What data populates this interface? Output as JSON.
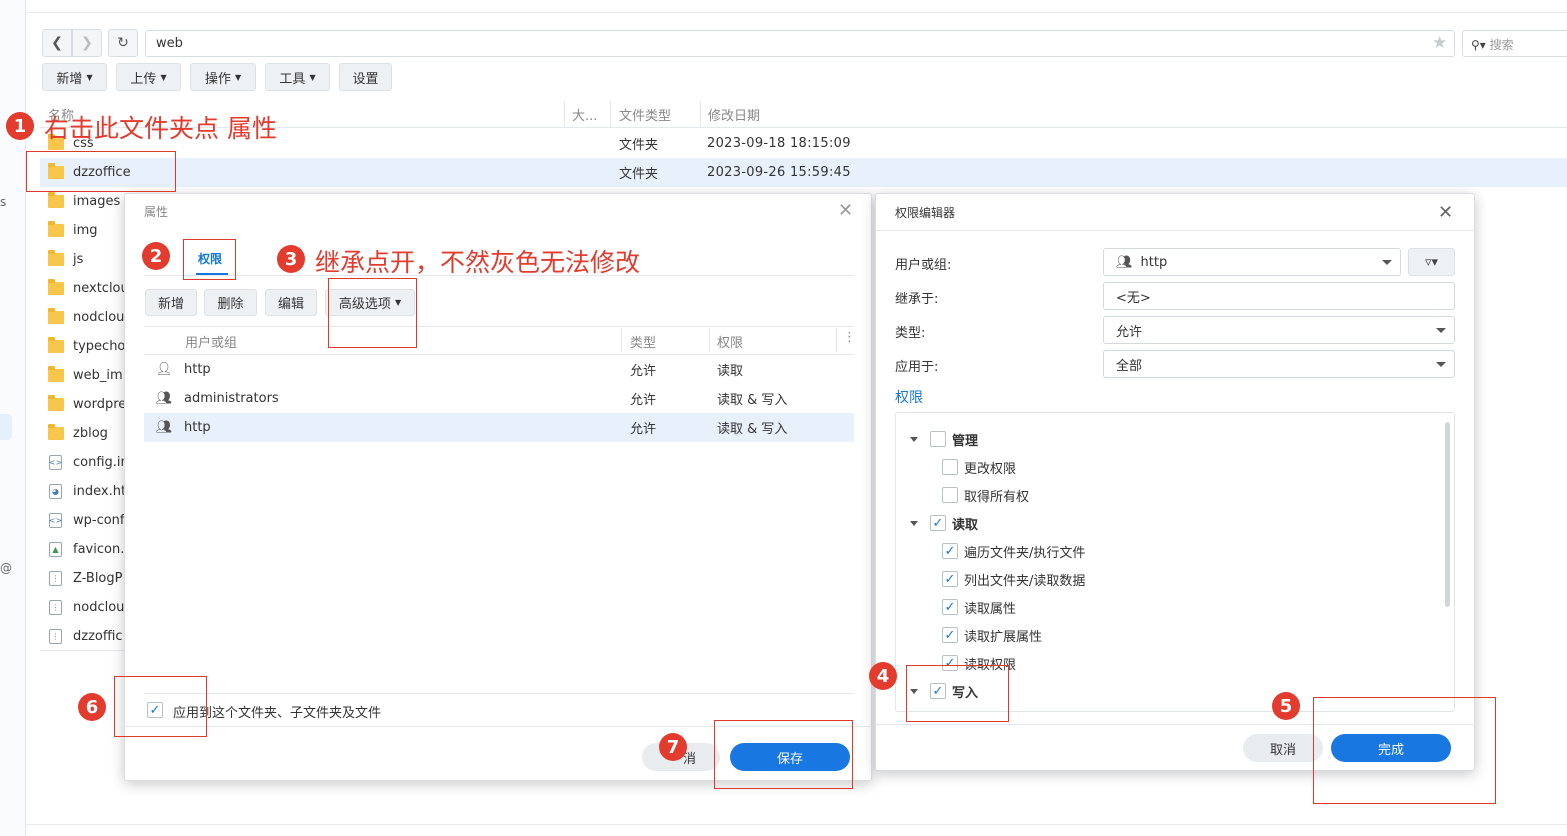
{
  "sidebar_strip": {
    "chars": [
      "s",
      "@"
    ]
  },
  "toolbar": {
    "back_icon": "chevron-left",
    "forward_icon": "chevron-right",
    "refresh_icon": "refresh",
    "path": "web",
    "search_placeholder": "搜索",
    "buttons": [
      "新增",
      "上传",
      "操作",
      "工具",
      "设置"
    ]
  },
  "file_list": {
    "columns": [
      "名称",
      "大...",
      "文件类型",
      "修改日期"
    ],
    "rows": [
      {
        "name": "css",
        "type": "文件夹",
        "date": "2023-09-18 18:15:09",
        "icon": "folder"
      },
      {
        "name": "dzzoffice",
        "type": "文件夹",
        "date": "2023-09-26 15:59:45",
        "icon": "folder"
      },
      {
        "name": "images",
        "type": "",
        "date": "",
        "icon": "folder"
      },
      {
        "name": "img",
        "type": "",
        "date": "",
        "icon": "folder"
      },
      {
        "name": "js",
        "type": "",
        "date": "",
        "icon": "folder"
      },
      {
        "name": "nextclou",
        "type": "",
        "date": "",
        "icon": "folder"
      },
      {
        "name": "nodclou",
        "type": "",
        "date": "",
        "icon": "folder"
      },
      {
        "name": "typecho",
        "type": "",
        "date": "",
        "icon": "folder"
      },
      {
        "name": "web_im",
        "type": "",
        "date": "",
        "icon": "folder"
      },
      {
        "name": "wordpre",
        "type": "",
        "date": "",
        "icon": "folder"
      },
      {
        "name": "zblog",
        "type": "",
        "date": "",
        "icon": "folder"
      },
      {
        "name": "config.in",
        "type": "",
        "date": "",
        "icon": "code"
      },
      {
        "name": "index.ht",
        "type": "",
        "date": "",
        "icon": "web"
      },
      {
        "name": "wp-conf",
        "type": "",
        "date": "",
        "icon": "code"
      },
      {
        "name": "favicon.",
        "type": "",
        "date": "",
        "icon": "image"
      },
      {
        "name": "Z-BlogP",
        "type": "",
        "date": "",
        "icon": "zip"
      },
      {
        "name": "nodclou",
        "type": "",
        "date": "",
        "icon": "zip"
      },
      {
        "name": "dzzoffic",
        "type": "",
        "date": "",
        "icon": "zip"
      }
    ]
  },
  "properties_dialog": {
    "title": "属性",
    "tab": "权限",
    "buttons": [
      "新增",
      "删除",
      "编辑",
      "高级选项"
    ],
    "columns": [
      "用户或组",
      "类型",
      "权限"
    ],
    "rows": [
      {
        "icon": "user",
        "name": "http",
        "type": "允许",
        "perm": "读取"
      },
      {
        "icon": "group",
        "name": "administrators",
        "type": "允许",
        "perm": "读取 & 写入"
      },
      {
        "icon": "group",
        "name": "http",
        "type": "允许",
        "perm": "读取 & 写入"
      }
    ],
    "apply_checkbox_label": "应用到这个文件夹、子文件夹及文件",
    "cancel_label": "消",
    "save_label": "保存"
  },
  "perm_editor": {
    "title": "权限编辑器",
    "user_group_label": "用户或组:",
    "user_group_value": "http",
    "inherit_label": "继承于:",
    "inherit_value": "<无>",
    "type_label": "类型:",
    "type_value": "允许",
    "apply_label": "应用于:",
    "apply_value": "全部",
    "perm_section": "权限",
    "tree": {
      "manage": "管理",
      "change_perm": "更改权限",
      "take_owner": "取得所有权",
      "read": "读取",
      "traverse": "遍历文件夹/执行文件",
      "list": "列出文件夹/读取数据",
      "read_attr": "读取属性",
      "read_ext_attr": "读取扩展属性",
      "read_perm": "读取权限",
      "write": "写入"
    },
    "cancel_label": "取消",
    "done_label": "完成"
  },
  "annotations": {
    "n1": "1",
    "t1": "右击此文件夹点 属性",
    "n2": "2",
    "n3": "3",
    "t3": "继承点开，不然灰色无法修改",
    "n4": "4",
    "n5": "5",
    "n6": "6",
    "n7": "7"
  },
  "colors": {
    "accent": "#1877e0",
    "annotation": "#e33b2e",
    "folder": "#f7c64b"
  }
}
